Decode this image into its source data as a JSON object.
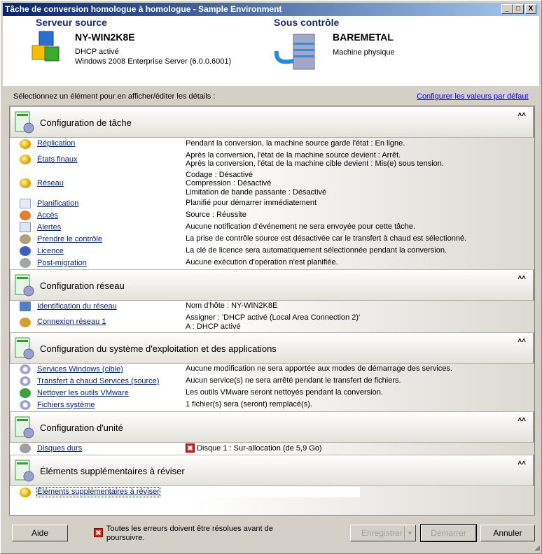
{
  "window": {
    "title": "Tâche de conversion homologue à homologue - Sample Environment",
    "min": "_",
    "max": "□",
    "close": "X"
  },
  "source": {
    "label": "Serveur source",
    "name": "NY-WIN2K8E",
    "line1": "DHCP activé",
    "line2": "Windows 2008 Enterprise Server (6.0.0.6001)"
  },
  "target": {
    "label": "Sous contrôle",
    "name": "BAREMETAL",
    "line1": "Machine physique"
  },
  "prompt": "Sélectionnez un élément pour en afficher/éditer les détails :",
  "default_link": "Configurer les valeurs par défaut",
  "collapse": "˄˄",
  "sections": [
    {
      "title": "Configuration de tâche",
      "rows": [
        {
          "icon": "gold-gear",
          "label": "Réplication",
          "lines": [
            "Pendant la conversion, la machine source garde l'état : En ligne."
          ]
        },
        {
          "icon": "gold-gear",
          "label": "États finaux",
          "lines": [
            "Après la conversion, l'état de la machine source devient : Arrêt.",
            "Après la conversion, l'état de la machine cible devient : Mis(e) sous tension."
          ]
        },
        {
          "icon": "gold-gear",
          "label": "Réseau",
          "lines": [
            "Codage : Désactivé",
            "Compression : Désactivé",
            "Limitation  de  bande  passante : Désactivé"
          ]
        },
        {
          "icon": "calendar",
          "label": "Planification",
          "lines": [
            "Planifié  pour  démarrer  immédiatement"
          ]
        },
        {
          "icon": "user-lock",
          "label": "Accès",
          "lines": [
            "Source : Réussite"
          ]
        },
        {
          "icon": "envelope",
          "label": "Alertes",
          "lines": [
            "Aucune notification d'événement ne sera envoyée pour cette tâche."
          ]
        },
        {
          "icon": "takeover",
          "label": "Prendre le contrôle",
          "lines": [
            "La prise de contrôle source est désactivée car le transfert à chaud est sélectionné."
          ]
        },
        {
          "icon": "key",
          "label": "Licence",
          "lines": [
            "La clé de licence sera automatiquement sélectionnée pendant la conversion."
          ]
        },
        {
          "icon": "script",
          "label": "Post-migration",
          "lines": [
            "Aucune exécution d'opération n'est planifiée."
          ]
        }
      ]
    },
    {
      "title": "Configuration réseau",
      "rows": [
        {
          "icon": "network-card",
          "label": "Identification du réseau",
          "lines": [
            "Nom d'hôte : NY-WIN2K8E"
          ]
        },
        {
          "icon": "network-connection",
          "label": "Connexion réseau 1",
          "lines": [
            "Assigner : 'DHCP activé (Local Area Connection 2)'",
            "A : DHCP activé"
          ]
        }
      ]
    },
    {
      "title": "Configuration du système d'exploitation et des applications",
      "rows": [
        {
          "icon": "gear",
          "label": "Services Windows (cible)",
          "lines": [
            "Aucune modification ne sera apportée aux modes de démarrage des services."
          ]
        },
        {
          "icon": "gear",
          "label": "Transfert à chaud Services (source)",
          "lines": [
            "Aucun service(s) ne sera arrêté pendant le transfert de fichiers."
          ]
        },
        {
          "icon": "vmware",
          "label": "Nettoyer les outils VMware",
          "lines": [
            "Les outils VMware seront nettoyés pendant la conversion."
          ]
        },
        {
          "icon": "gear",
          "label": "Fichiers système",
          "lines": [
            "1 fichier(s) sera (seront) remplacé(s)."
          ]
        }
      ]
    },
    {
      "title": "Configuration d'unité",
      "rows": [
        {
          "icon": "disk",
          "label": "Disques durs",
          "error": true,
          "lines": [
            "Disque 1 :  Sur-allocation (de 5,9 Go)"
          ]
        }
      ]
    },
    {
      "title": "Éléments supplémentaires à réviser",
      "rows": [
        {
          "icon": "gold-gear",
          "label": "Éléments  supplémentaires  à  réviser",
          "lines": [
            ""
          ]
        }
      ]
    }
  ],
  "footer": {
    "help": "Aide",
    "error": "Toutes les erreurs doivent être résolues avant de poursuivre.",
    "save": "Enregistrer",
    "start": "Démarrer",
    "cancel": "Annuler"
  }
}
